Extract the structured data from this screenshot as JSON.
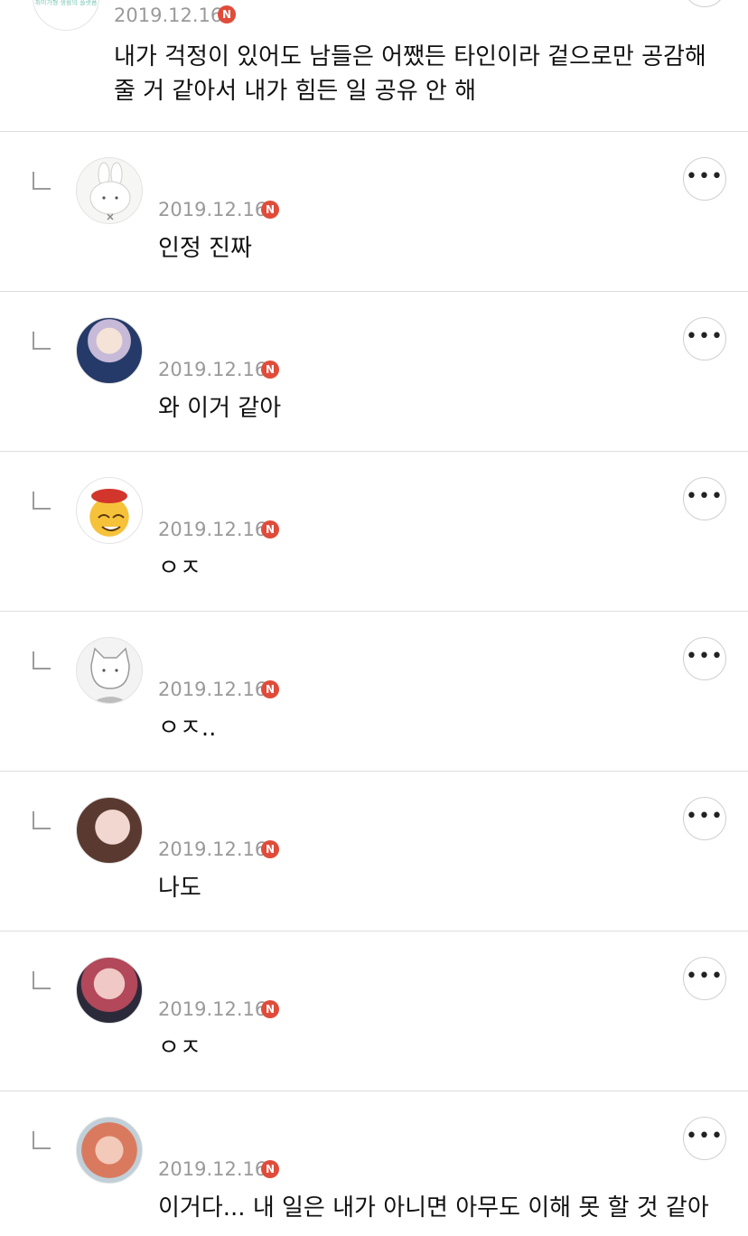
{
  "top_comment": {
    "avatar_logo_text": "취미가형 생활의 플랫폼",
    "date": "2019.12.16",
    "badge": "N",
    "text": "내가 걱정이 있어도 남들은 어쨌든 타인이라 겉으로만 공감해 줄 거 같아서 내가 힘든 일 공유 안 해"
  },
  "replies": [
    {
      "nickname": "",
      "date": "2019.12.16",
      "badge": "N",
      "text": "인정 진짜",
      "avatar_icon": "rabbit-avatar"
    },
    {
      "nickname": "",
      "date": "2019.12.16",
      "badge": "N",
      "text": "와 이거 같아",
      "avatar_icon": "princess-avatar"
    },
    {
      "nickname": "",
      "date": "2019.12.16",
      "badge": "N",
      "text": "ㅇㅈ",
      "avatar_icon": "emoji-avatar"
    },
    {
      "nickname": "",
      "date": "2019.12.16",
      "badge": "N",
      "text": "ㅇㅈ..",
      "avatar_icon": "cat-avatar"
    },
    {
      "nickname": "",
      "date": "2019.12.16",
      "badge": "N",
      "text": "나도",
      "avatar_icon": "portrait-avatar"
    },
    {
      "nickname": "",
      "date": "2019.12.16",
      "badge": "N",
      "text": "ㅇㅈ",
      "avatar_icon": "portrait-avatar"
    },
    {
      "nickname": "",
      "date": "2019.12.16",
      "badge": "N",
      "text": "이거다... 내 일은 내가 아니면 아무도 이해 못 할 것 같아",
      "avatar_icon": "portrait-avatar"
    }
  ],
  "colors": {
    "badge": "#e04b3a",
    "date": "#9a9a9a",
    "divider": "#dddddd"
  }
}
